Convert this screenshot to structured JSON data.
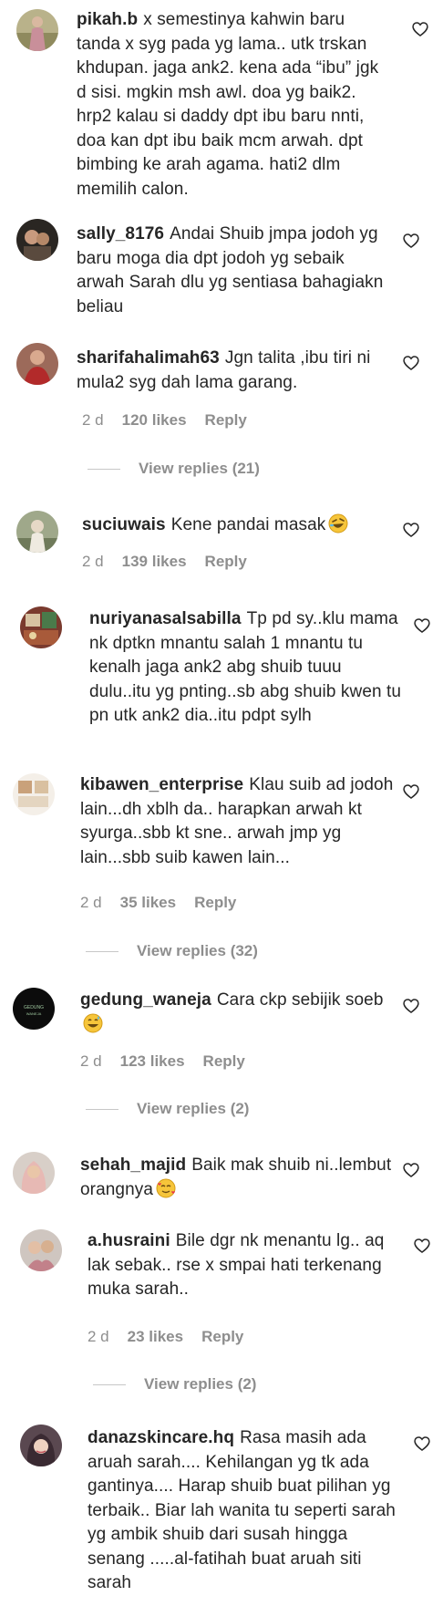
{
  "comments": [
    {
      "username": "pikah.b",
      "text": "x semestinya kahwin baru tanda x syg pada yg lama.. utk trskan khdupan. jaga ank2. kena ada “ibu” jgk d sisi. mgkin msh awl. doa yg baik2. hrp2 kalau si daddy dpt ibu baru nnti, doa kan dpt ibu baik mcm arwah. dpt bimbing ke arah agama. hati2 dlm memilih calon."
    },
    {
      "username": "sally_8176",
      "text": "Andai Shuib jmpa jodoh yg baru moga dia dpt jodoh yg sebaik arwah Sarah dlu yg sentiasa bahagiakn beliau"
    },
    {
      "username": "sharifahalimah63",
      "text": "Jgn talita ,ibu tiri ni mula2 syg dah lama garang.",
      "age": "2 d",
      "likes": "120 likes",
      "reply": "Reply",
      "view_replies": "View replies (21)"
    },
    {
      "username": "suciuwais",
      "text": "Kene pandai masak",
      "emoji": "rolling-on-floor-laughing",
      "age": "2 d",
      "likes": "139 likes",
      "reply": "Reply"
    },
    {
      "username": "nuriyanasalsabilla",
      "text": "Tp pd sy..klu mama nk dptkn mnantu salah 1 mnantu tu kenalh jaga ank2 abg shuib tuuu dulu..itu yg pnting..sb abg shuib kwen tu pn utk ank2 dia..itu pdpt sylh"
    },
    {
      "username": "kibawen_enterprise",
      "text": "Klau suib ad jodoh lain...dh xblh da.. harapkan arwah kt syurga..sbb kt sne.. arwah jmp yg lain...sbb suib kawen lain...",
      "age": "2 d",
      "likes": "35 likes",
      "reply": "Reply",
      "view_replies": "View replies (32)"
    },
    {
      "username": "gedung_waneja",
      "text": "Cara ckp sebijik soeb",
      "emoji": "grinning-sweat",
      "age": "2 d",
      "likes": "123 likes",
      "reply": "Reply",
      "view_replies": "View replies (2)",
      "avatar_text": "GEDUNG WANEJA"
    },
    {
      "username": "sehah_majid",
      "text": "Baik mak shuib ni..lembut orangnya",
      "emoji": "smiling-hearts"
    },
    {
      "username": "a.husraini",
      "text": "Bile dgr nk menantu lg.. aq lak sebak.. rse x smpai hati terkenang muka sarah..",
      "age": "2 d",
      "likes": "23 likes",
      "reply": "Reply",
      "view_replies": "View replies (2)"
    },
    {
      "username": "danazskincare.hq",
      "text": "Rasa masih ada aruah sarah.... Kehilangan yg tk ada gantinya.... Harap shuib buat pilihan yg terbaik.. Biar lah wanita tu seperti sarah yg ambik shuib dari susah hingga senang .....al-fatihah buat aruah siti sarah"
    }
  ],
  "icons": {
    "like": "heart-outline-icon"
  },
  "colors": {
    "text": "#262626",
    "meta": "#8e8e8e",
    "divider": "#c7c7c7"
  }
}
